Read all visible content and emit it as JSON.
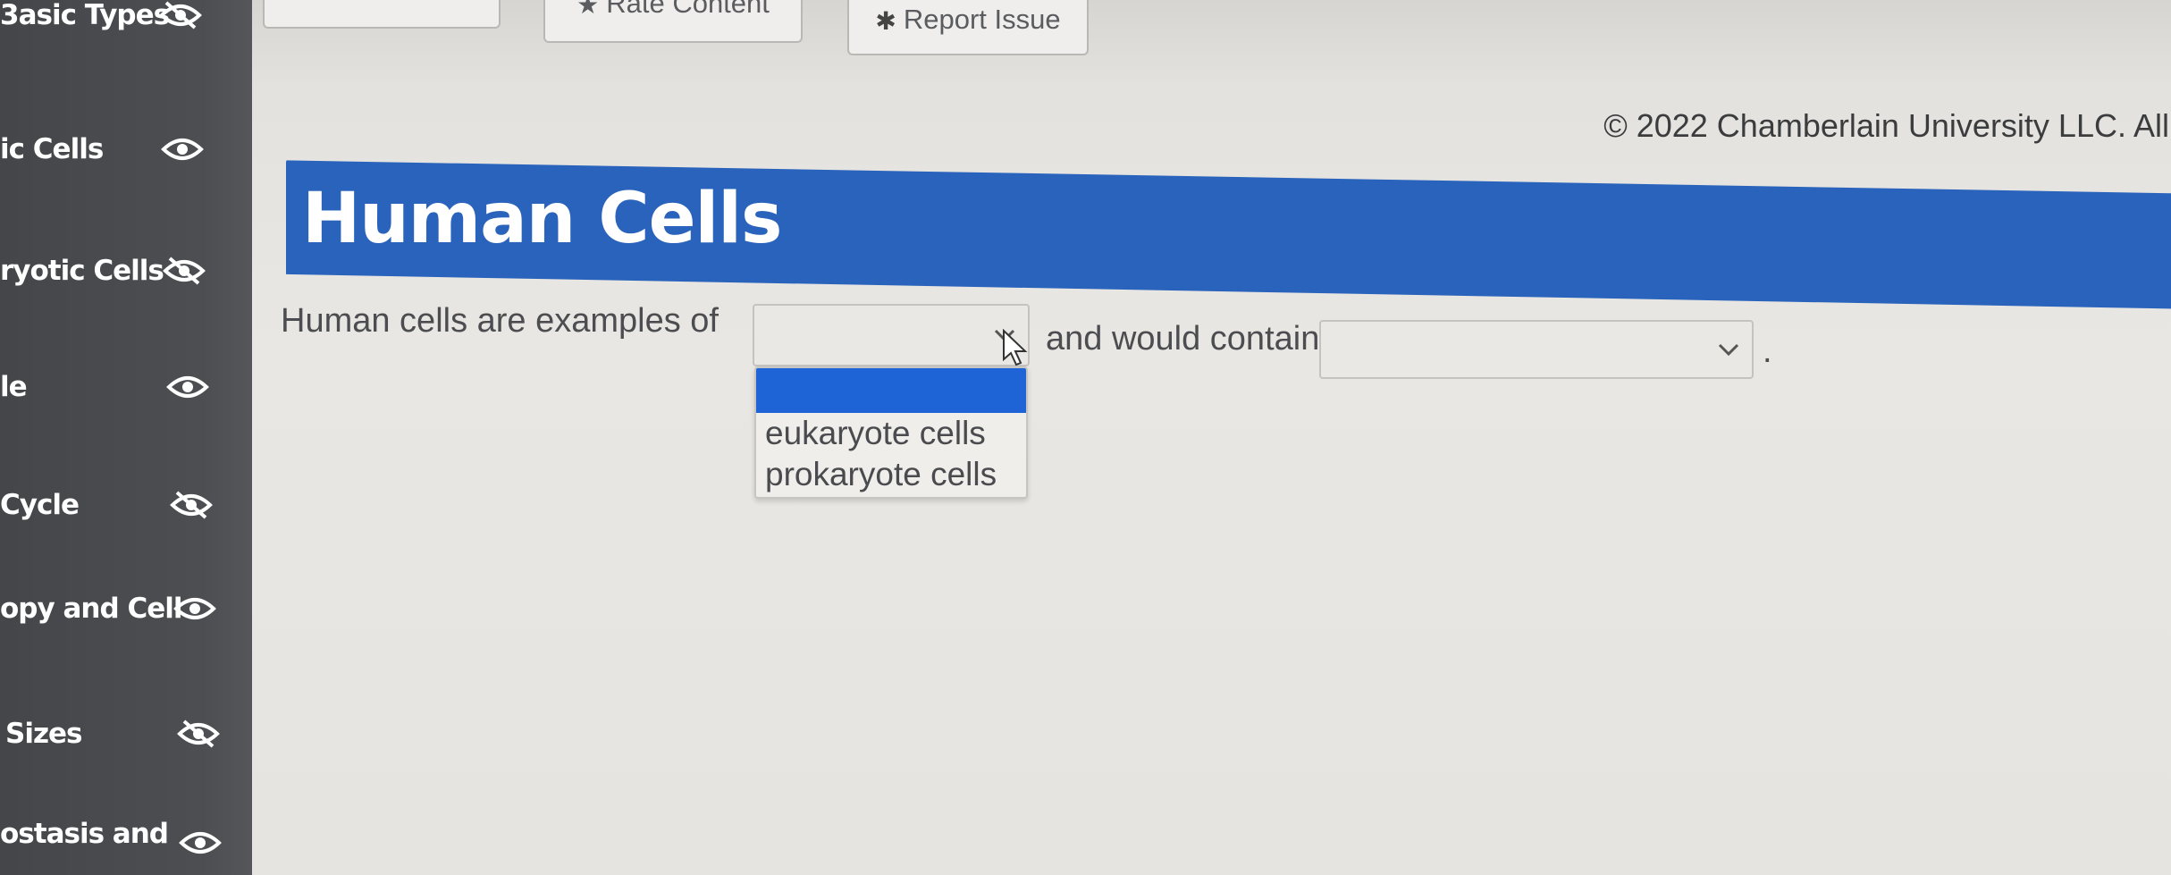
{
  "sidebar": {
    "items": [
      {
        "label": "3asic Types",
        "icon": "eye-slash-icon"
      },
      {
        "label": "ic Cells",
        "icon": "eye-icon"
      },
      {
        "label": "ryotic Cells",
        "icon": "eye-slash-icon"
      },
      {
        "label": "le",
        "icon": "eye-icon"
      },
      {
        "label": "Cycle",
        "icon": "eye-slash-icon"
      },
      {
        "label": "opy and Cell",
        "icon": "eye-icon"
      },
      {
        "label": "Sizes",
        "icon": "eye-slash-icon"
      },
      {
        "label": "ostasis and",
        "icon": "eye-icon"
      }
    ]
  },
  "toolbar": {
    "rate_label": "Rate Content",
    "report_label": "Report Issue"
  },
  "footer": {
    "copyright": "© 2022 Chamberlain University LLC. All"
  },
  "page": {
    "title": "Human Cells"
  },
  "question": {
    "part1": "Human cells are examples of",
    "part2": "and would contain",
    "end": ".",
    "select1_value": "",
    "select2_value": "",
    "options": [
      "",
      "eukaryote cells",
      "prokaryote cells"
    ]
  },
  "colors": {
    "title_bar": "#2a63bc",
    "sidebar": "#4a4b4f",
    "selected_option": "#1f64d6"
  }
}
